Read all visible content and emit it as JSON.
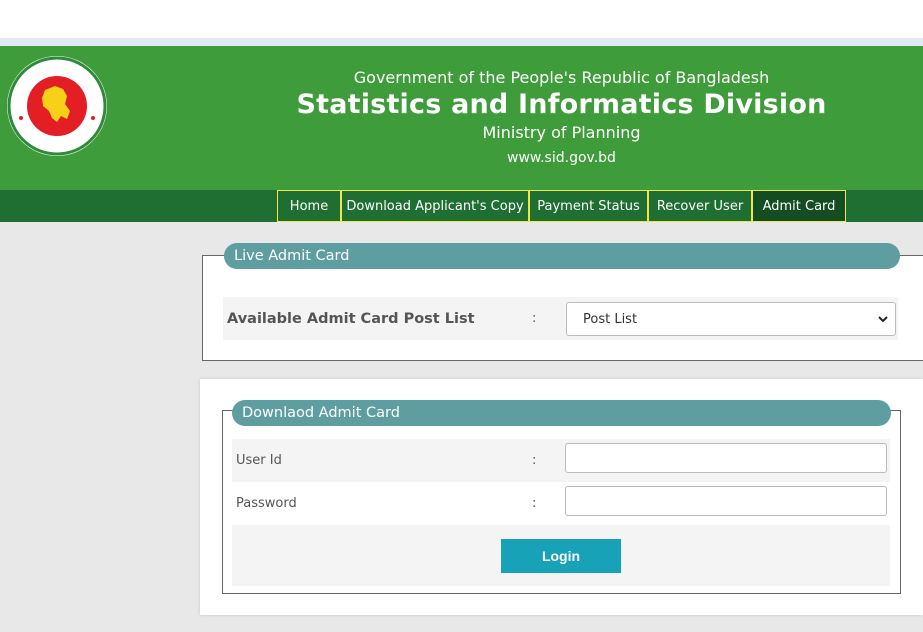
{
  "header": {
    "line1": "Government of the People's Republic of Bangladesh",
    "title": "Statistics and Informatics Division",
    "subtitle": "Ministry of Planning",
    "website": "www.sid.gov.bd",
    "logo_icon": "bangladesh-government-seal-icon"
  },
  "nav": {
    "items": [
      {
        "label": "Home"
      },
      {
        "label": "Download Applicant's Copy"
      },
      {
        "label": "Payment Status"
      },
      {
        "label": "Recover User"
      },
      {
        "label": "Admit Card"
      }
    ],
    "active": "Admit Card"
  },
  "live_admit": {
    "legend": "Live Admit Card",
    "label": "Available Admit Card Post List",
    "colon": ":",
    "select_value": "Post List"
  },
  "download_admit": {
    "legend": "Downlaod Admit Card",
    "user_label": "User Id",
    "password_label": "Password",
    "colon": ":",
    "user_value": "",
    "password_value": "",
    "login_label": "Login"
  },
  "colors": {
    "header_green": "#3e9c3a",
    "nav_green": "#1f6e32",
    "nav_border": "#f0e64a",
    "legend_teal": "#5f9ea0",
    "button": "#17a2b8"
  }
}
